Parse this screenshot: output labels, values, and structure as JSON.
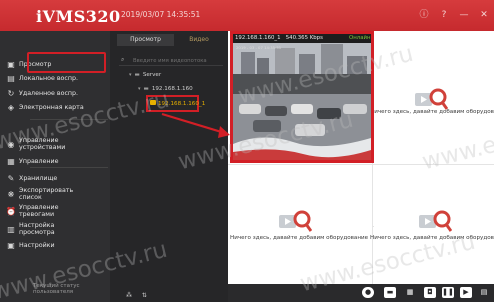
{
  "app": {
    "logo": "iVMS320",
    "datetime": "2019/03/07 14:35:51",
    "window_icons": [
      "info-icon",
      "help-icon",
      "minimize-icon",
      "close-icon"
    ]
  },
  "nav": {
    "items": [
      {
        "label": "Просмотр",
        "icon": "monitor-icon",
        "selected": true
      },
      {
        "label": "Локальное воспр.",
        "icon": "playback-icon"
      },
      {
        "label": "Удаленное воспр.",
        "icon": "remote-playback-icon"
      },
      {
        "label": "Электронная карта",
        "icon": "map-icon"
      },
      {
        "label": "Управление\nустройствами",
        "icon": "device-manager-icon"
      },
      {
        "label": "Управление",
        "icon": "management-icon"
      },
      {
        "label": "Хранилище",
        "icon": "storage-icon"
      },
      {
        "label": "Экспортировать\nсписок",
        "icon": "export-icon"
      },
      {
        "label": "Управление\nтревогами",
        "icon": "alarm-icon"
      },
      {
        "label": "Настройка\nпросмотра",
        "icon": "view-settings-icon"
      },
      {
        "label": "Настройки",
        "icon": "settings-icon"
      }
    ],
    "user_label": "Текущий статус пользователя"
  },
  "midpanel": {
    "tabs": [
      "Просмотр",
      "Видео"
    ],
    "search_placeholder": "Введите имя видеопотока",
    "tree": {
      "root": "Server",
      "device": "192.168.1.160",
      "camera": "192.168.1.160_1"
    }
  },
  "live": {
    "title": "192.168.1.160_1",
    "bitrate": "540.365 Kbps",
    "status": "Онлайн",
    "timestamp": "2019 - 03 - 07 14:35:51"
  },
  "placeholder_text": "Ничего здесь, давайте добавим оборудование",
  "watermark": "www.esocctv.ru",
  "colors": {
    "accent": "#d21f26",
    "online": "#78c43a",
    "selected_camera": "#e8b100"
  }
}
